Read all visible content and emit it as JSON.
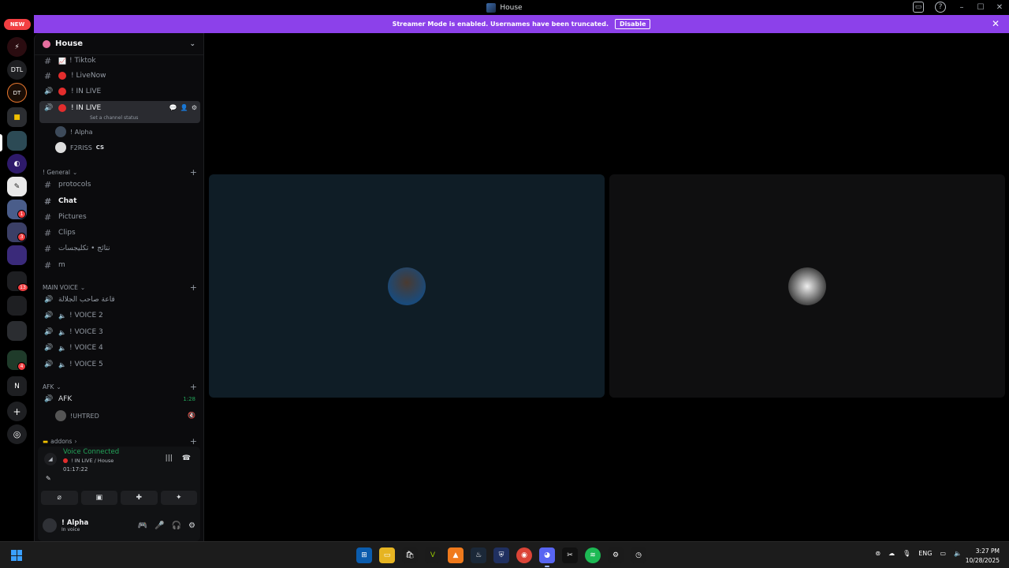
{
  "window": {
    "title": "House"
  },
  "banner": {
    "text": "Streamer Mode is enabled. Usernames have been truncated.",
    "button": "Disable"
  },
  "rail": {
    "new_label": "NEW",
    "dtl_label": "DTL",
    "badges": [
      "1",
      "3",
      "13",
      "4"
    ]
  },
  "server": {
    "name": "House"
  },
  "channels": {
    "tiktok": "! Tiktok",
    "livenow": "! LiveNow",
    "inlive1": "! IN LIVE",
    "inlive_active": "! IN LIVE",
    "status_hint": "Set a channel status",
    "member_alpha": "! Alpha",
    "member_f2riss": "F2RISS",
    "member_f2riss_tag": "CS",
    "cat_general": "! General",
    "protocols": "protocols",
    "chat": "Chat",
    "pictures": "Pictures",
    "clips": "Clips",
    "arabic_chan": "نتائج • تكليجسات",
    "m": "m",
    "cat_main_voice": "MAIN VOICE",
    "arabic_voice": "قاعة صاحب الجلالة",
    "voice2": "! VOICE 2",
    "voice3": "! VOICE 3",
    "voice4": "! VOICE 4",
    "voice5": "! VOICE 5",
    "cat_afk": "AFK",
    "afk": "AFK",
    "afk_timer": "1:28",
    "member_uhtred": "!UHTRED",
    "cat_addons": "addons"
  },
  "voice": {
    "status": "Voice Connected",
    "channel": "! IN LIVE / House",
    "elapsed": "01:17:22"
  },
  "user": {
    "name": "! Alpha",
    "sub": "In voice"
  },
  "taskbar": {
    "lang": "ENG",
    "time": "3:27 PM",
    "date": "10/28/2025"
  },
  "colors": {
    "accent_banner": "#8c41ea",
    "voice_green": "#23a55a",
    "live_red": "#e32d2d",
    "tile_left": "#0f1d26",
    "tile_right": "#0f0f10"
  }
}
